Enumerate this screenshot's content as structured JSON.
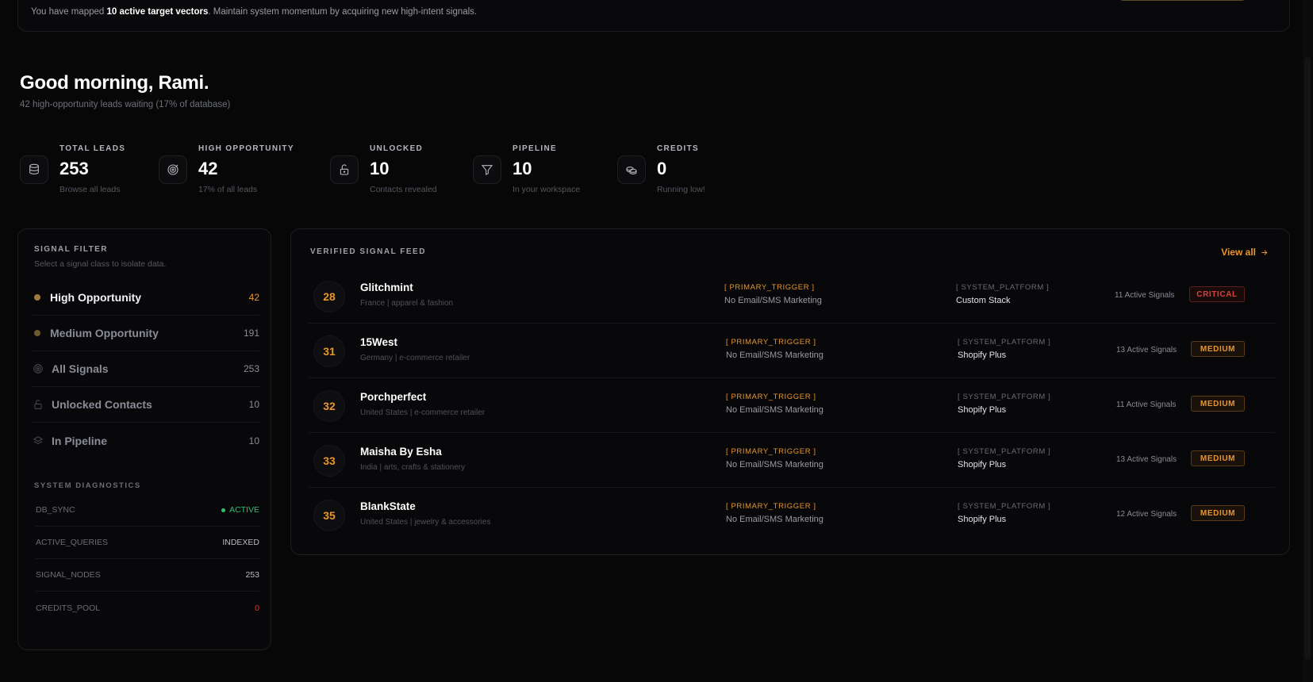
{
  "banner": {
    "text_prefix": "You have mapped ",
    "text_bold": "10 active target vectors",
    "text_suffix": ". Maintain system momentum by acquiring new high-intent signals."
  },
  "greeting": {
    "title": "Good morning, Rami.",
    "subtitle": "42 high-opportunity leads waiting (17% of database)"
  },
  "stats": [
    {
      "label": "TOTAL LEADS",
      "value": "253",
      "sub": "Browse all leads",
      "icon": "database-icon"
    },
    {
      "label": "HIGH OPPORTUNITY",
      "value": "42",
      "sub": "17% of all leads",
      "icon": "target-icon"
    },
    {
      "label": "UNLOCKED",
      "value": "10",
      "sub": "Contacts revealed",
      "icon": "unlock-icon"
    },
    {
      "label": "PIPELINE",
      "value": "10",
      "sub": "In your workspace",
      "icon": "filter-icon"
    },
    {
      "label": "CREDITS",
      "value": "0",
      "sub": "Running low!",
      "icon": "coins-icon"
    }
  ],
  "filter": {
    "title": "SIGNAL FILTER",
    "subtitle": "Select a signal class to isolate data.",
    "items": [
      {
        "label": "High Opportunity",
        "count": "42",
        "marker": "dot",
        "color": "#a07a3a"
      },
      {
        "label": "Medium Opportunity",
        "count": "191",
        "marker": "dot",
        "color": "#6e5a2e"
      },
      {
        "label": "All Signals",
        "count": "253",
        "marker": "target-icon"
      },
      {
        "label": "Unlocked Contacts",
        "count": "10",
        "marker": "unlock-icon"
      },
      {
        "label": "In Pipeline",
        "count": "10",
        "marker": "layers-icon"
      }
    ]
  },
  "diagnostics": {
    "title": "SYSTEM DIAGNOSTICS",
    "rows": [
      {
        "key": "DB_SYNC",
        "value": "ACTIVE",
        "status": "green"
      },
      {
        "key": "ACTIVE_QUERIES",
        "value": "INDEXED",
        "status": "normal"
      },
      {
        "key": "SIGNAL_NODES",
        "value": "253",
        "status": "normal"
      },
      {
        "key": "CREDITS_POOL",
        "value": "0",
        "status": "red"
      }
    ]
  },
  "feed": {
    "title": "VERIFIED SIGNAL FEED",
    "view_all": "View all",
    "rows": [
      {
        "score": "28",
        "name": "Glitchmint",
        "meta": "France | apparel & fashion",
        "trigger_label": "[ PRIMARY_TRIGGER ]",
        "trigger": "No Email/SMS Marketing",
        "platform_label": "[ SYSTEM_PLATFORM ]",
        "platform": "Custom Stack",
        "signals": "11 Active Signals",
        "badge": "CRITICAL",
        "badge_type": "critical"
      },
      {
        "score": "31",
        "name": "15West",
        "meta": "Germany | e-commerce retailer",
        "trigger_label": "[ PRIMARY_TRIGGER ]",
        "trigger": "No Email/SMS Marketing",
        "platform_label": "[ SYSTEM_PLATFORM ]",
        "platform": "Shopify Plus",
        "signals": "13 Active Signals",
        "badge": "MEDIUM",
        "badge_type": "medium"
      },
      {
        "score": "32",
        "name": "Porchperfect",
        "meta": "United States | e-commerce retailer",
        "trigger_label": "[ PRIMARY_TRIGGER ]",
        "trigger": "No Email/SMS Marketing",
        "platform_label": "[ SYSTEM_PLATFORM ]",
        "platform": "Shopify Plus",
        "signals": "11 Active Signals",
        "badge": "MEDIUM",
        "badge_type": "medium"
      },
      {
        "score": "33",
        "name": "Maisha By Esha",
        "meta": "India | arts, crafts & stationery",
        "trigger_label": "[ PRIMARY_TRIGGER ]",
        "trigger": "No Email/SMS Marketing",
        "platform_label": "[ SYSTEM_PLATFORM ]",
        "platform": "Shopify Plus",
        "signals": "13 Active Signals",
        "badge": "MEDIUM",
        "badge_type": "medium"
      },
      {
        "score": "35",
        "name": "BlankState",
        "meta": "United States | jewelry & accessories",
        "trigger_label": "[ PRIMARY_TRIGGER ]",
        "trigger": "No Email/SMS Marketing",
        "platform_label": "[ SYSTEM_PLATFORM ]",
        "platform": "Shopify Plus",
        "signals": "12 Active Signals",
        "badge": "MEDIUM",
        "badge_type": "medium"
      }
    ]
  }
}
